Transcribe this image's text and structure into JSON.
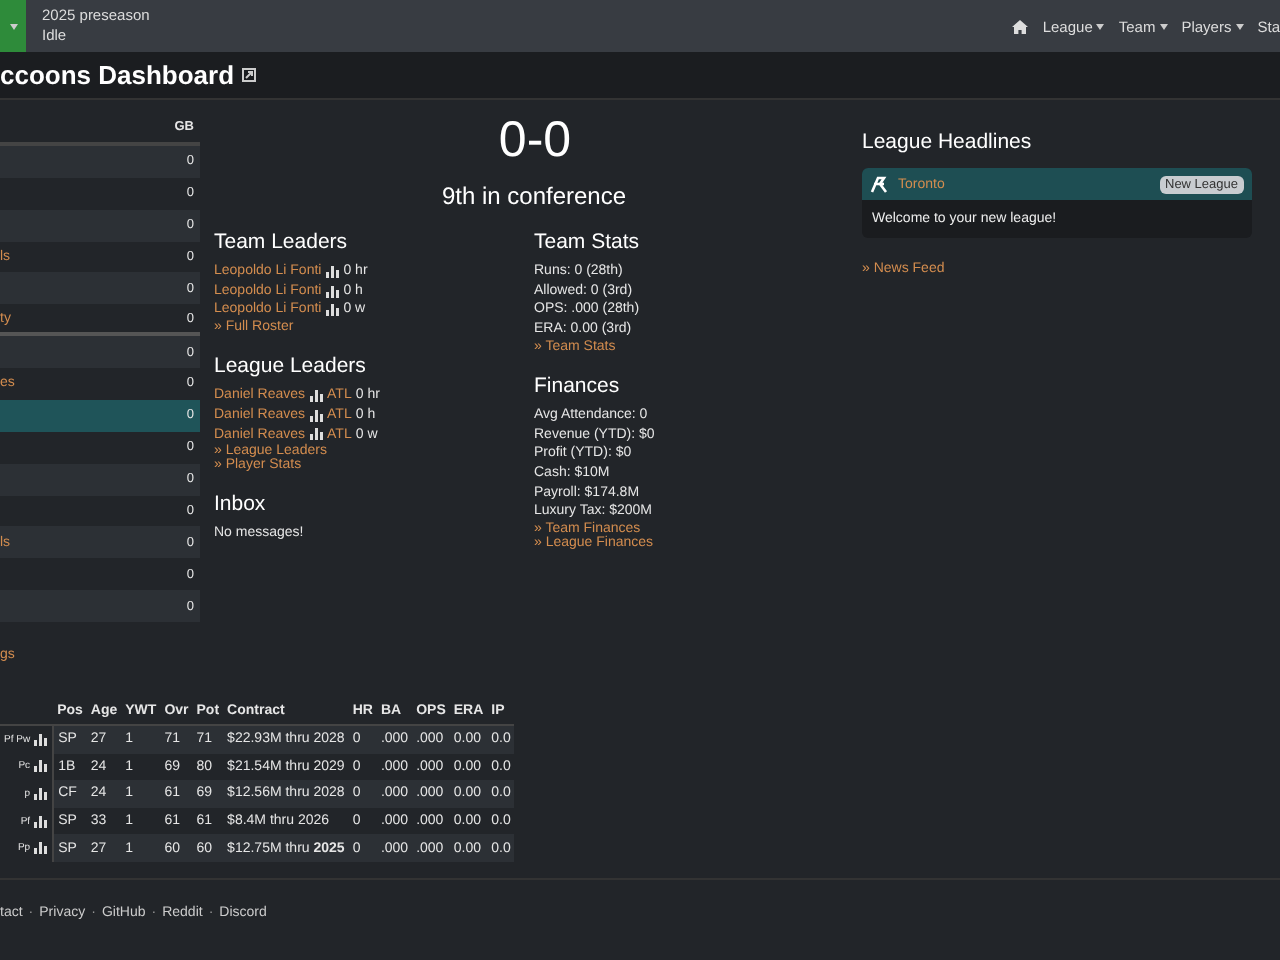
{
  "topbar": {
    "season": "2025 preseason",
    "status": "Idle",
    "nav": [
      {
        "label": "League",
        "kind": "menu"
      },
      {
        "label": "Team",
        "kind": "menu"
      },
      {
        "label": "Players",
        "kind": "menu"
      },
      {
        "label": "Sta",
        "kind": "cut"
      }
    ]
  },
  "title": "ccoons Dashboard",
  "standings": {
    "column": "GB",
    "rows": [
      {
        "team": "",
        "gb": "0",
        "selected": false,
        "divider": false
      },
      {
        "team": "",
        "gb": "0",
        "selected": false,
        "divider": false
      },
      {
        "team": "",
        "gb": "0",
        "selected": false,
        "divider": false
      },
      {
        "team": "ls",
        "gb": "0",
        "selected": false,
        "divider": false
      },
      {
        "team": "",
        "gb": "0",
        "selected": false,
        "divider": false
      },
      {
        "team": "ty",
        "gb": "0",
        "selected": false,
        "divider": true
      },
      {
        "team": "",
        "gb": "0",
        "selected": false,
        "divider": false
      },
      {
        "team": "es",
        "gb": "0",
        "selected": false,
        "divider": false
      },
      {
        "team": "",
        "gb": "0",
        "selected": true,
        "divider": false
      },
      {
        "team": "",
        "gb": "0",
        "selected": false,
        "divider": false
      },
      {
        "team": "",
        "gb": "0",
        "selected": false,
        "divider": false
      },
      {
        "team": "",
        "gb": "0",
        "selected": false,
        "divider": false
      },
      {
        "team": "ls",
        "gb": "0",
        "selected": false,
        "divider": false
      },
      {
        "team": "",
        "gb": "0",
        "selected": false,
        "divider": false
      },
      {
        "team": "",
        "gb": "0",
        "selected": false,
        "divider": false
      }
    ],
    "link": "gs"
  },
  "record": "0-0",
  "rank": "9th in conference",
  "team_leaders": {
    "heading": "Team Leaders",
    "items": [
      {
        "name": "Leopoldo Li Fonti",
        "stat": "0 hr"
      },
      {
        "name": "Leopoldo Li Fonti",
        "stat": "0 h"
      },
      {
        "name": "Leopoldo Li Fonti",
        "stat": "0 w"
      }
    ],
    "links": [
      "» Full Roster"
    ]
  },
  "league_leaders": {
    "heading": "League Leaders",
    "items": [
      {
        "name": "Daniel Reaves",
        "team": "ATL",
        "stat": "0 hr"
      },
      {
        "name": "Daniel Reaves",
        "team": "ATL",
        "stat": "0 h"
      },
      {
        "name": "Daniel Reaves",
        "team": "ATL",
        "stat": "0 w"
      }
    ],
    "links": [
      "» League Leaders",
      "» Player Stats"
    ]
  },
  "inbox": {
    "heading": "Inbox",
    "text": "No messages!"
  },
  "team_stats": {
    "heading": "Team Stats",
    "lines": [
      "Runs: 0 (28th)",
      "Allowed: 0 (3rd)",
      "OPS: .000 (28th)",
      "ERA: 0.00 (3rd)"
    ],
    "links": [
      "» Team Stats"
    ]
  },
  "finances": {
    "heading": "Finances",
    "lines": [
      "Avg Attendance: 0",
      "Revenue (YTD): $0",
      "Profit (YTD): $0",
      "Cash: $10M",
      "Payroll: $174.8M",
      "Luxury Tax: $200M"
    ],
    "links": [
      "» Team Finances",
      "» League Finances"
    ]
  },
  "headlines": {
    "heading": "League Headlines",
    "team": "Toronto",
    "badge": "New League",
    "text": "Welcome to your new league!",
    "link": "» News Feed"
  },
  "roster": {
    "columns": [
      "Pos",
      "Age",
      "YWT",
      "Ovr",
      "Pot",
      "Contract",
      "HR",
      "BA",
      "OPS",
      "ERA",
      "IP"
    ],
    "rows": [
      {
        "tags": "Pf Pw",
        "cells": [
          "SP",
          "27",
          "1",
          "71",
          "71",
          "$22.93M thru 2028",
          "0",
          ".000",
          ".000",
          "0.00",
          "0.0"
        ]
      },
      {
        "tags": "Pc",
        "cells": [
          "1B",
          "24",
          "1",
          "69",
          "80",
          "$21.54M thru 2029",
          "0",
          ".000",
          ".000",
          "0.00",
          "0.0"
        ]
      },
      {
        "tags": "p",
        "cells": [
          "CF",
          "24",
          "1",
          "61",
          "69",
          "$12.56M thru 2028",
          "0",
          ".000",
          ".000",
          "0.00",
          "0.0"
        ]
      },
      {
        "tags": "Pf",
        "cells": [
          "SP",
          "33",
          "1",
          "61",
          "61",
          "$8.4M thru 2026",
          "0",
          ".000",
          ".000",
          "0.00",
          "0.0"
        ]
      },
      {
        "tags": "Pp",
        "cells": [
          "SP",
          "27",
          "1",
          "60",
          "60",
          "$12.75M thru **2025**",
          "0",
          ".000",
          ".000",
          "0.00",
          "0.0"
        ]
      }
    ]
  },
  "footer": {
    "separator": "·",
    "links": [
      "tact",
      "Privacy",
      "GitHub",
      "Reddit",
      "Discord"
    ]
  }
}
